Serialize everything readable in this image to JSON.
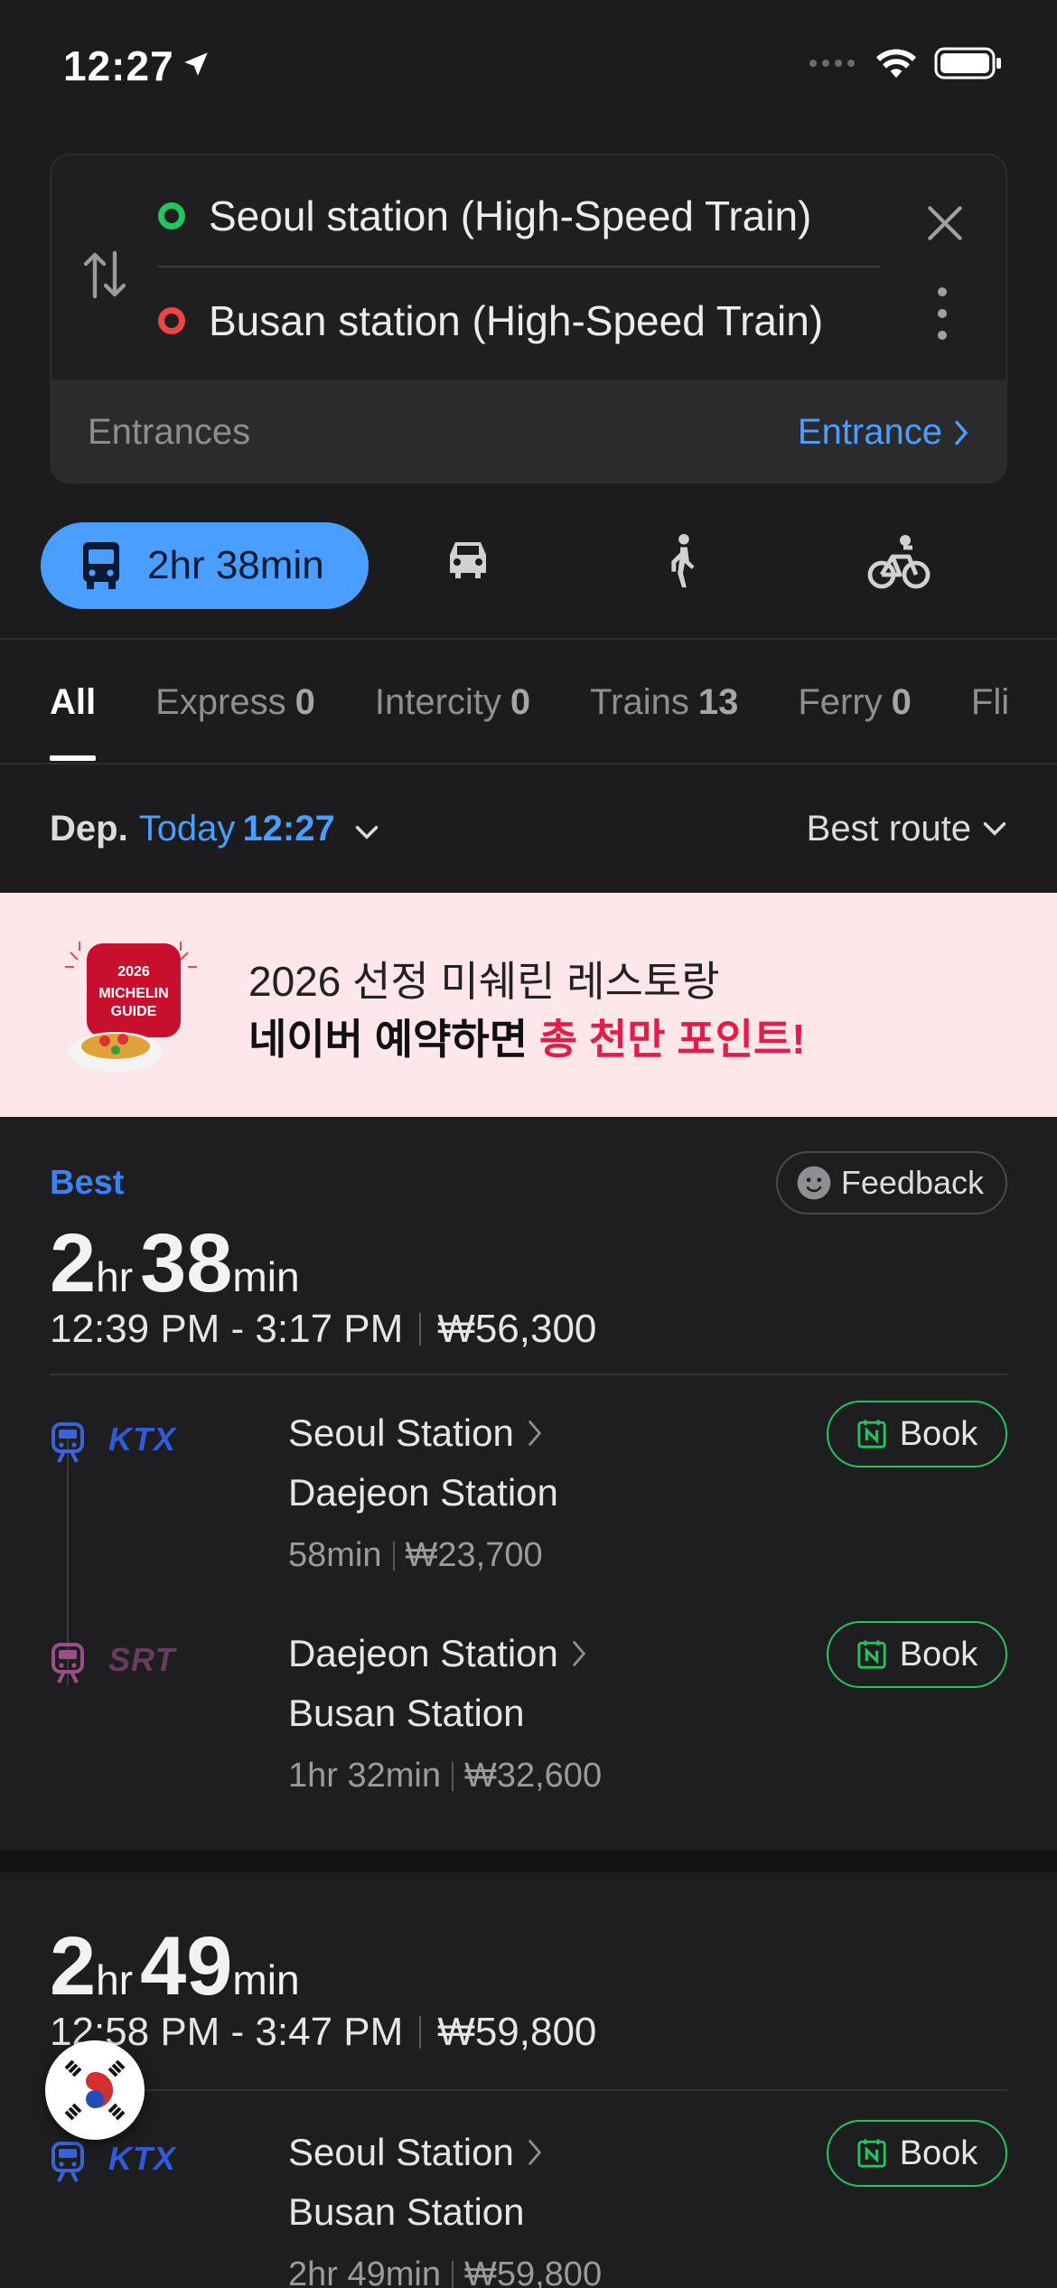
{
  "status_bar": {
    "time": "12:27"
  },
  "route": {
    "origin": "Seoul station (High-Speed Train)",
    "destination": "Busan station (High-Speed Train)",
    "entrances_label": "Entrances",
    "entrance_link": "Entrance"
  },
  "modes": {
    "transit_label": "2hr 38min"
  },
  "tabs": [
    {
      "label": "All",
      "count": ""
    },
    {
      "label": "Express",
      "count": "0"
    },
    {
      "label": "Intercity",
      "count": "0"
    },
    {
      "label": "Trains",
      "count": "13"
    },
    {
      "label": "Ferry",
      "count": "0"
    },
    {
      "label": "Fli",
      "count": ""
    }
  ],
  "departure": {
    "prefix": "Dep.",
    "day": "Today",
    "time": "12:27",
    "sort": "Best route"
  },
  "banner": {
    "badge_year": "2026",
    "badge_line1": "MICHELIN",
    "badge_line2": "GUIDE",
    "line1": "2026 선정 미쉐린 레스토랑",
    "line2_prefix": "네이버 예약하면 ",
    "line2_highlight": "총 천만 포인트!"
  },
  "results": [
    {
      "tag": "Best",
      "feedback": "Feedback",
      "hours": "2",
      "hr_unit": "hr",
      "minutes": "38",
      "min_unit": "min",
      "time_range": "12:39 PM - 3:17 PM",
      "fare": "₩56,300",
      "legs": [
        {
          "operator": "KTX",
          "from": "Seoul Station",
          "to": "Daejeon Station",
          "duration": "58min",
          "fare": "₩23,700",
          "book": "Book"
        },
        {
          "operator": "SRT",
          "from": "Daejeon Station",
          "to": "Busan Station",
          "duration": "1hr 32min",
          "fare": "₩32,600",
          "book": "Book"
        }
      ]
    },
    {
      "hours": "2",
      "hr_unit": "hr",
      "minutes": "49",
      "min_unit": "min",
      "time_range": "12:58 PM - 3:47 PM",
      "fare": "₩59,800",
      "legs": [
        {
          "operator": "KTX",
          "from": "Seoul Station",
          "to": "Busan Station",
          "duration": "2hr 49min",
          "fare": "₩59,800",
          "book": "Book"
        }
      ]
    }
  ],
  "colors": {
    "accent": "#4a9eff",
    "best": "#3b82f6",
    "book_border": "#22c55e",
    "ktx": "#2f5bd8",
    "srt": "#8a4a7a",
    "banner_bg": "#fde7ea",
    "banner_highlight": "#e11d48"
  }
}
